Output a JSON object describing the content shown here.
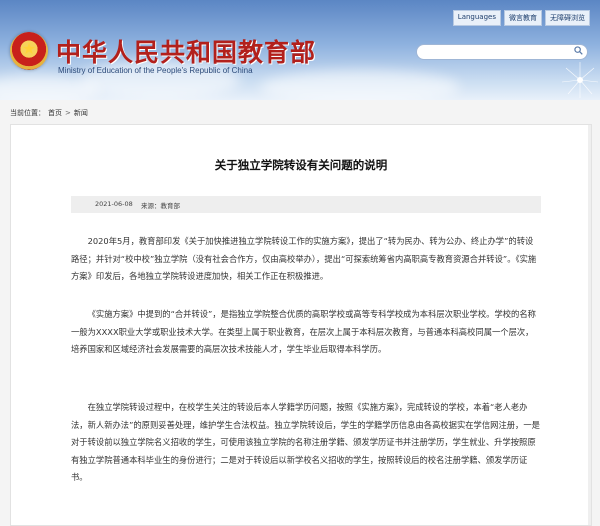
{
  "header": {
    "title": "中华人民共和国教育部",
    "subtitle": "Ministry of Education of the People's Republic of China",
    "top_links": [
      "Languages",
      "微言教育",
      "无障碍浏览"
    ],
    "search_placeholder": ""
  },
  "breadcrumb": {
    "label": "当前位置：",
    "items": [
      "首页",
      "新闻"
    ],
    "separator": ">"
  },
  "article": {
    "title": "关于独立学院转设有关问题的说明",
    "date": "2021-06-08",
    "source": "来源：教育部",
    "paragraphs": [
      "2020年5月，教育部印发《关于加快推进独立学院转设工作的实施方案》，提出了“转为民办、转为公办、终止办学”的转设路径；并针对“校中校”独立学院（没有社会合作方，仅由高校举办），提出“可探索统筹省内高职高专教育资源合并转设”。《实施方案》印发后，各地独立学院转设进度加快，相关工作正在积极推进。",
      "《实施方案》中提到的“合并转设”，是指独立学院整合优质的高职学校或高等专科学校成为本科层次职业学校。学校的名称一般为XXXX职业大学或职业技术大学。在类型上属于职业教育，在层次上属于本科层次教育，与普通本科高校同属一个层次，培养国家和区域经济社会发展需要的高层次技术技能人才，学生毕业后取得本科学历。",
      "在独立学院转设过程中，在校学生关注的转设后本人学籍学历问题，按照《实施方案》，完成转设的学校，本着“老人老办法，新人新办法”的原则妥善处理，维护学生合法权益。独立学院转设后，学生的学籍学历信息由各高校据实在学信网注册，一是对于转设前以独立学院名义招收的学生，可使用该独立学院的名称注册学籍、颁发学历证书并注册学历，学生就业、升学按照原有独立学院普通本科毕业生的身份进行；二是对于转设后以新学校名义招收的学生，按照转设后的校名注册学籍、颁发学历证书。"
    ]
  },
  "colors": {
    "brand_red": "#b2201c",
    "header_blue": "#5b86c4"
  }
}
